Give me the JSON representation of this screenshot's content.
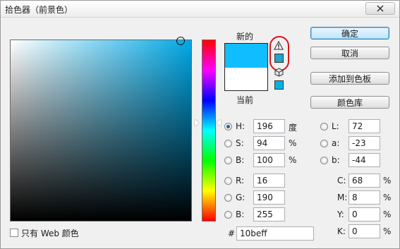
{
  "window": {
    "title": "拾色器（前景色）"
  },
  "swatch": {
    "new_label": "新的",
    "current_label": "当前",
    "new_color": "#10beff",
    "current_color": "#ffffff",
    "gamut_color": "#22a3c9",
    "web_color": "#00b3e6"
  },
  "buttons": {
    "ok": "确定",
    "cancel": "取消",
    "add_to_swatches": "添加到色板",
    "color_libraries": "颜色库"
  },
  "hsb": {
    "h": {
      "label": "H:",
      "value": "196",
      "unit": "度"
    },
    "s": {
      "label": "S:",
      "value": "94",
      "unit": "%"
    },
    "b": {
      "label": "B:",
      "value": "100",
      "unit": "%"
    }
  },
  "rgb": {
    "r": {
      "label": "R:",
      "value": "16"
    },
    "g": {
      "label": "G:",
      "value": "190"
    },
    "b": {
      "label": "B:",
      "value": "255"
    }
  },
  "lab": {
    "l": {
      "label": "L:",
      "value": "72"
    },
    "a": {
      "label": "a:",
      "value": "-23"
    },
    "b": {
      "label": "b:",
      "value": "-44"
    }
  },
  "cmyk": {
    "c": {
      "label": "C:",
      "value": "68",
      "unit": "%"
    },
    "m": {
      "label": "M:",
      "value": "8",
      "unit": "%"
    },
    "y": {
      "label": "Y:",
      "value": "0",
      "unit": "%"
    },
    "k": {
      "label": "K:",
      "value": "0",
      "unit": "%"
    }
  },
  "hex": {
    "label": "#",
    "value": "10beff"
  },
  "web_only": {
    "label": "只有 Web 颜色",
    "checked": false
  },
  "icons": {
    "close": "close-icon",
    "gamut_warning": "warning-triangle-icon",
    "web_safe": "cube-icon"
  }
}
